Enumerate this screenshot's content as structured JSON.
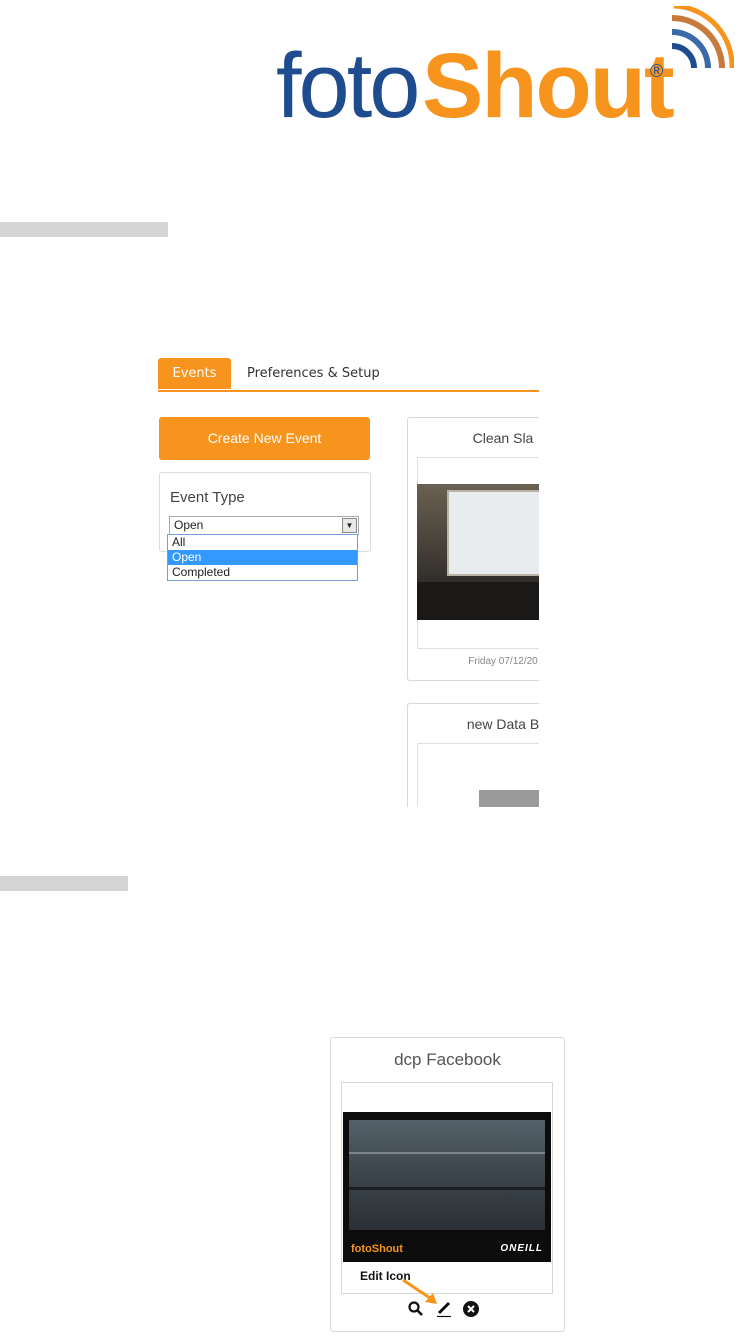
{
  "logo": {
    "part1": "foto",
    "part2": "Shout",
    "registered": "®"
  },
  "colors": {
    "brand_orange": "#f7941d",
    "brand_blue": "#1f4c8f"
  },
  "screenshot_events": {
    "tabs": [
      {
        "label": "Events",
        "active": true
      },
      {
        "label": "Preferences & Setup",
        "active": false
      }
    ],
    "create_button": "Create New Event",
    "filter": {
      "title": "Event Type",
      "selected": "Open",
      "options": [
        {
          "label": "All"
        },
        {
          "label": "Open",
          "highlighted": true
        },
        {
          "label": "Completed"
        }
      ]
    },
    "cards": [
      {
        "title": "Clean Sla",
        "date": "Friday 07/12/20"
      },
      {
        "title": "new Data B"
      }
    ]
  },
  "screenshot_edit": {
    "card_title": "dcp Facebook",
    "watermark_brand": "fotoShout",
    "watermark_partner": "ONEILL",
    "callout": "Edit Icon",
    "icons": [
      "magnifier-icon",
      "pencil-icon",
      "close-circle-icon"
    ]
  }
}
